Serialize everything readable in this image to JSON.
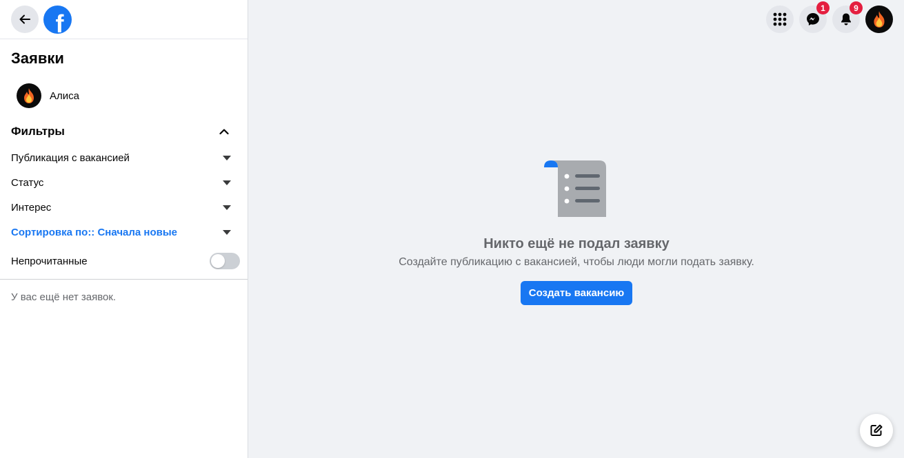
{
  "sidebar": {
    "title": "Заявки",
    "profile": {
      "name": "Алиса",
      "avatar_icon": "fire-icon"
    },
    "filters": {
      "label": "Фильтры",
      "items": [
        {
          "label": "Публикация с вакансией"
        },
        {
          "label": "Статус"
        },
        {
          "label": "Интерес"
        },
        {
          "label": "Сортировка по:: Сначала новые"
        }
      ],
      "unread_label": "Непрочитанные",
      "unread_on": false
    },
    "empty_note": "У вас ещё нет заявок."
  },
  "topbar": {
    "messenger_badge": "1",
    "notifications_badge": "9"
  },
  "empty_state": {
    "title": "Никто ещё не подал заявку",
    "subtitle": "Создайте публикацию с вакансией, чтобы люди могли подать заявку.",
    "button_label": "Создать вакансию"
  },
  "colors": {
    "accent": "#1877f2",
    "badge": "#e41e3f",
    "background": "#f0f2f5"
  }
}
